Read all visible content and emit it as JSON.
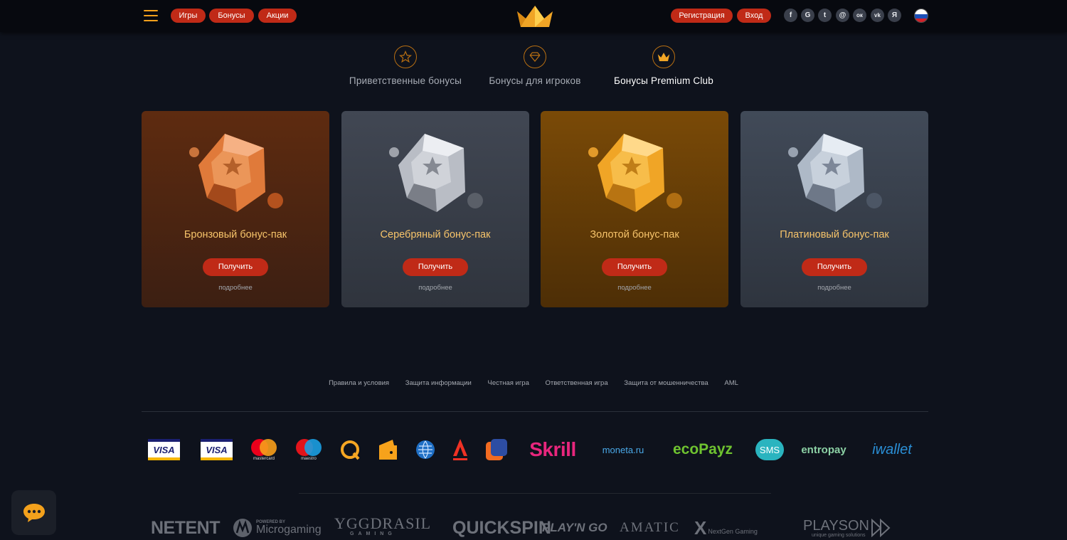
{
  "header": {
    "nav": [
      "Игры",
      "Бонусы",
      "Акции"
    ],
    "register_label": "Регистрация",
    "login_label": "Вход",
    "social": [
      {
        "icon": "facebook-icon",
        "glyph": "f"
      },
      {
        "icon": "google-icon",
        "glyph": "G"
      },
      {
        "icon": "twitter-icon",
        "glyph": "t"
      },
      {
        "icon": "mailru-icon",
        "glyph": "@"
      },
      {
        "icon": "odnoklassniki-icon",
        "glyph": "ок"
      },
      {
        "icon": "vk-icon",
        "glyph": "vk"
      },
      {
        "icon": "yandex-icon",
        "glyph": "Я"
      }
    ]
  },
  "tabs": [
    {
      "label": "Приветственные бонусы",
      "icon": "star-icon",
      "active": false
    },
    {
      "label": "Бонусы для игроков",
      "icon": "diamond-icon",
      "active": false
    },
    {
      "label": "Бонусы Premium Club",
      "icon": "crown-icon",
      "active": true
    }
  ],
  "cards": [
    {
      "title": "Бронзовый бонус-пак",
      "button": "Получить",
      "more": "подробнее",
      "gem_color": "#e07a3a"
    },
    {
      "title": "Серебряный бонус-пак",
      "button": "Получить",
      "more": "подробнее",
      "gem_color": "#c9ccd3"
    },
    {
      "title": "Золотой бонус-пак",
      "button": "Получить",
      "more": "подробнее",
      "gem_color": "#f0a526"
    },
    {
      "title": "Платиновый бонус-пак",
      "button": "Получить",
      "more": "подробнее",
      "gem_color": "#b9c3d0"
    }
  ],
  "footer_links": [
    "Правила и условия",
    "Защита информации",
    "Честная игра",
    "Ответственная игра",
    "Защита от мошенничества",
    "AML"
  ],
  "payments": [
    "VISA",
    "VISA",
    "mastercard",
    "maestro",
    "QIWI",
    "Яндекс.Деньги",
    "WebMoney",
    "Альфа-Банк",
    "Промсвязьбанк",
    "Skrill",
    "moneta.ru",
    "ecoPayz",
    "SMS",
    "entropay",
    "iwallet"
  ],
  "providers": [
    "NETENT",
    "POWERED BY",
    "Microgaming",
    "YGGDRASIL",
    "GAMING",
    "QUICKSPIN",
    "PLAY'N GO",
    "AMATIC",
    "NextGen Gaming",
    "PLAYSON",
    "unique gaming solutions"
  ],
  "colors": {
    "accent": "#c02a17",
    "gold": "#f7c46a",
    "background": "#0e121c"
  }
}
